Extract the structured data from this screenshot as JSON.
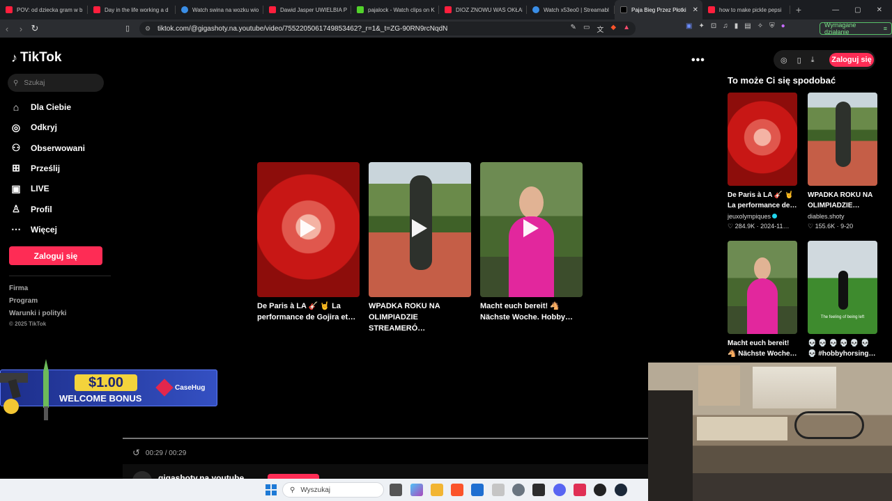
{
  "browser": {
    "tabs": [
      {
        "label": "POV: od dziecka gram w b",
        "icon": "youtube-icon"
      },
      {
        "label": "Day in the life working a d",
        "icon": "youtube-icon"
      },
      {
        "label": "Watch swina na wozku wio",
        "icon": "streamable-icon"
      },
      {
        "label": "Dawid Jasper UWIELBIA P",
        "icon": "youtube-icon"
      },
      {
        "label": "pajalock - Watch clips on K",
        "icon": "kick-icon"
      },
      {
        "label": "DIOZ ZNOWU WAS OKŁAM",
        "icon": "youtube-icon"
      },
      {
        "label": "Watch x53eo0 | Streamabl",
        "icon": "streamable-icon"
      },
      {
        "label": "Paja Bieg Przez Płotki",
        "icon": "tiktok-icon",
        "active": true
      },
      {
        "label": "how to make pickle pepsi",
        "icon": "youtube-icon"
      }
    ],
    "url": "tiktok.com/@gigashoty.na.youtube/video/7552205061749853462?_r=1&_t=ZG-90RN9rcNqdN",
    "action_required": "Wymagane działanie"
  },
  "tiktok": {
    "logo": "TikTok",
    "search_placeholder": "Szukaj",
    "menu": [
      {
        "label": "Dla Ciebie",
        "icon": "home-icon"
      },
      {
        "label": "Odkryj",
        "icon": "compass-icon"
      },
      {
        "label": "Obserwowani",
        "icon": "following-icon"
      },
      {
        "label": "Prześlij",
        "icon": "upload-icon"
      },
      {
        "label": "LIVE",
        "icon": "live-icon"
      },
      {
        "label": "Profil",
        "icon": "profile-icon"
      },
      {
        "label": "Więcej",
        "icon": "more-icon"
      }
    ],
    "login": "Zaloguj się",
    "footer": [
      "Firma",
      "Program",
      "Warunki i polityki"
    ],
    "copyright": "© 2025 TikTok",
    "top_login": "Zaloguj się",
    "may_like": "To może Ci się spodobać",
    "center_cards": [
      {
        "title": "De Paris à LA 🎸 🤘 La performance de Gojira et…",
        "thumb": "red"
      },
      {
        "title": "WPADKA ROKU NA OLIMPIADZIE STREAMERÓ…",
        "thumb": "track"
      },
      {
        "title": "Macht euch bereit! 🐴 Nächste Woche. Hobby…",
        "thumb": "park"
      }
    ],
    "recommended": [
      {
        "title1": "De Paris à LA 🎸 🤘",
        "title2": "La performance de…",
        "author": "jeuxolympiques",
        "verified": true,
        "likes": "284.9K",
        "date": "2024-11…",
        "thumb": "red"
      },
      {
        "title1": "WPADKA ROKU NA",
        "title2": "OLIMPIADZIE…",
        "author": "diables.shoty",
        "verified": false,
        "likes": "155.6K",
        "date": "9-20",
        "thumb": "track"
      },
      {
        "title1": "Macht euch bereit!",
        "title2": "🐴 Nächste Woche…",
        "author": "",
        "verified": false,
        "likes": "",
        "date": "",
        "thumb": "park"
      },
      {
        "title1": "💀 💀 💀 💀 💀 💀",
        "title2": "💀 #hobbyhorsing…",
        "author": "",
        "verified": false,
        "likes": "",
        "date": "",
        "thumb": "field",
        "caption": "The feeling of being left"
      }
    ],
    "video_time": "00:29 / 00:29",
    "author_name": "gigashoty.na.youtube"
  },
  "ad": {
    "price": "$1.00",
    "text": "WELCOME BONUS",
    "brand": "CaseHug"
  },
  "taskbar": {
    "search_placeholder": "Wyszukaj"
  },
  "colors": {
    "accent": "#fe2c55",
    "bg": "#000000"
  }
}
